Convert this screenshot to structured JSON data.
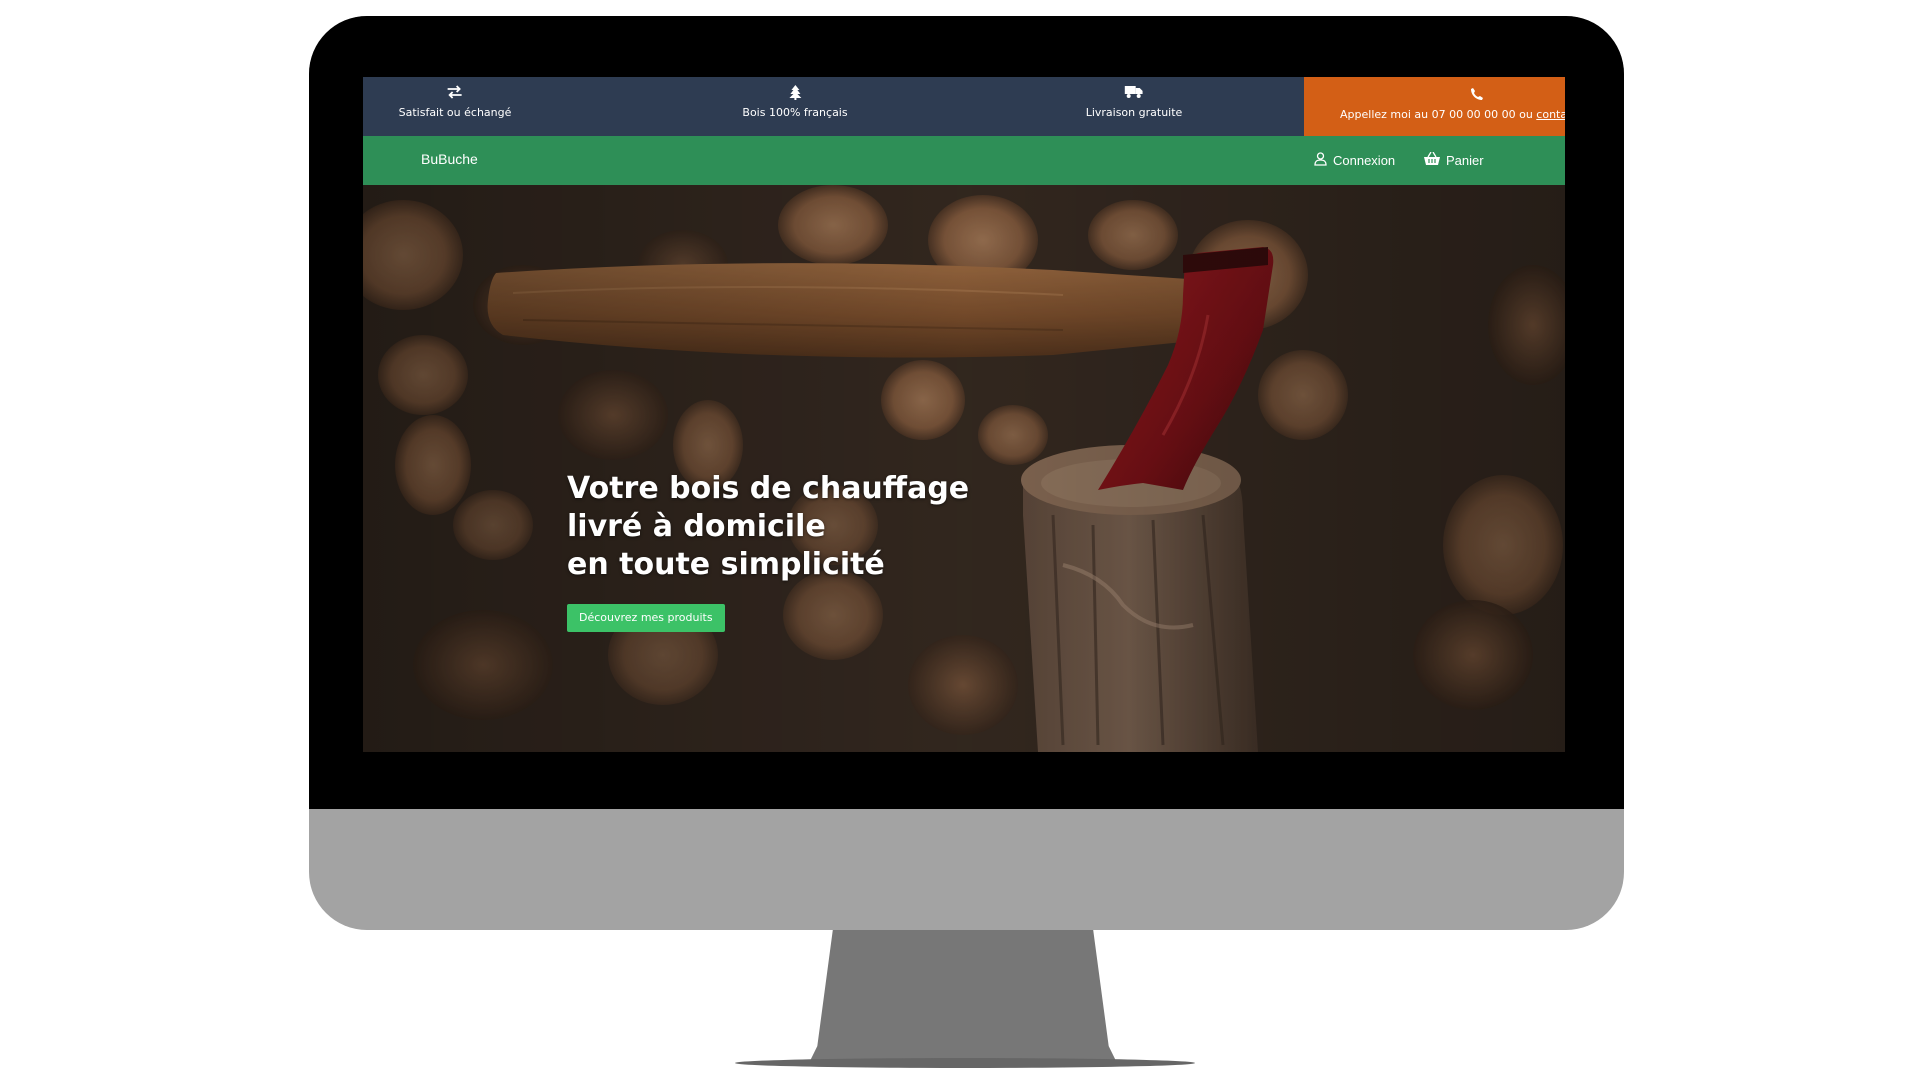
{
  "topbar": {
    "items": [
      {
        "label": "Satisfait ou échangé",
        "icon": "exchange-arrows-icon"
      },
      {
        "label": "Bois 100% français",
        "icon": "tree-icon"
      },
      {
        "label": "Livraison gratuite",
        "icon": "truck-icon"
      }
    ],
    "cta": {
      "icon": "phone-icon",
      "text": "Appellez moi au 07 00 00 00 00 ou",
      "link": "contactez"
    }
  },
  "navbar": {
    "brand": "BuBuche",
    "login": {
      "label": "Connexion",
      "icon": "user-icon"
    },
    "cart": {
      "label": "Panier",
      "icon": "basket-icon"
    }
  },
  "hero": {
    "title_lines": [
      "Votre bois de chauffage",
      "livré à domicile",
      "en toute simplicité"
    ],
    "button": "Découvrez mes produits",
    "image_subject": "axe-in-log-with-firewood-stack"
  },
  "colors": {
    "topbar_bg": "#2e3c52",
    "cta_bg": "#d35f16",
    "navbar_bg": "#2e8f57",
    "hero_button_bg": "#3cc267",
    "monitor_bezel": "#000000",
    "monitor_chin": "#a3a3a3",
    "stand": "#777777"
  }
}
